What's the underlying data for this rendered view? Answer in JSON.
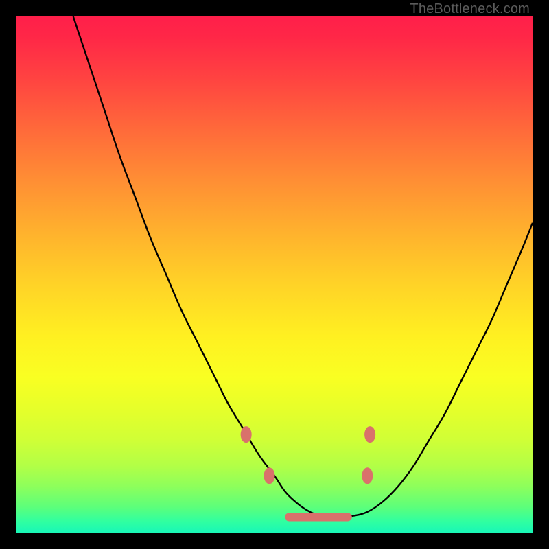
{
  "attribution": "TheBottleneck.com",
  "chart_data": {
    "type": "line",
    "title": "",
    "xlabel": "",
    "ylabel": "",
    "xlim": [
      0,
      100
    ],
    "ylim": [
      0,
      100
    ],
    "grid": false,
    "series": [
      {
        "name": "bottleneck-curve",
        "color": "#000000",
        "x": [
          11,
          14,
          17,
          20,
          23,
          26,
          29,
          32,
          35,
          38,
          41,
          44,
          47,
          50,
          52,
          54,
          56,
          58,
          60,
          62,
          65,
          68,
          71,
          74,
          77,
          80,
          83,
          86,
          89,
          92,
          95,
          98,
          100
        ],
        "y": [
          100,
          91,
          82,
          73,
          65,
          57,
          50,
          43,
          37,
          31,
          25,
          20,
          15,
          11,
          8,
          6,
          4.5,
          3.5,
          3,
          3,
          3.2,
          4,
          6,
          9,
          13,
          18,
          23,
          29,
          35,
          41,
          48,
          55,
          60
        ]
      }
    ],
    "markers": [
      {
        "name": "left-upper-marker",
        "color": "#d9716b",
        "x": 44.5,
        "y": 19
      },
      {
        "name": "left-lower-marker",
        "color": "#d9716b",
        "x": 49,
        "y": 11
      },
      {
        "name": "right-upper-marker",
        "color": "#d9716b",
        "x": 68.5,
        "y": 19
      },
      {
        "name": "right-lower-marker",
        "color": "#d9716b",
        "x": 68,
        "y": 11
      }
    ],
    "flat_zone": {
      "color": "#d9716b",
      "x_start": 52,
      "x_end": 65,
      "y": 3
    }
  }
}
